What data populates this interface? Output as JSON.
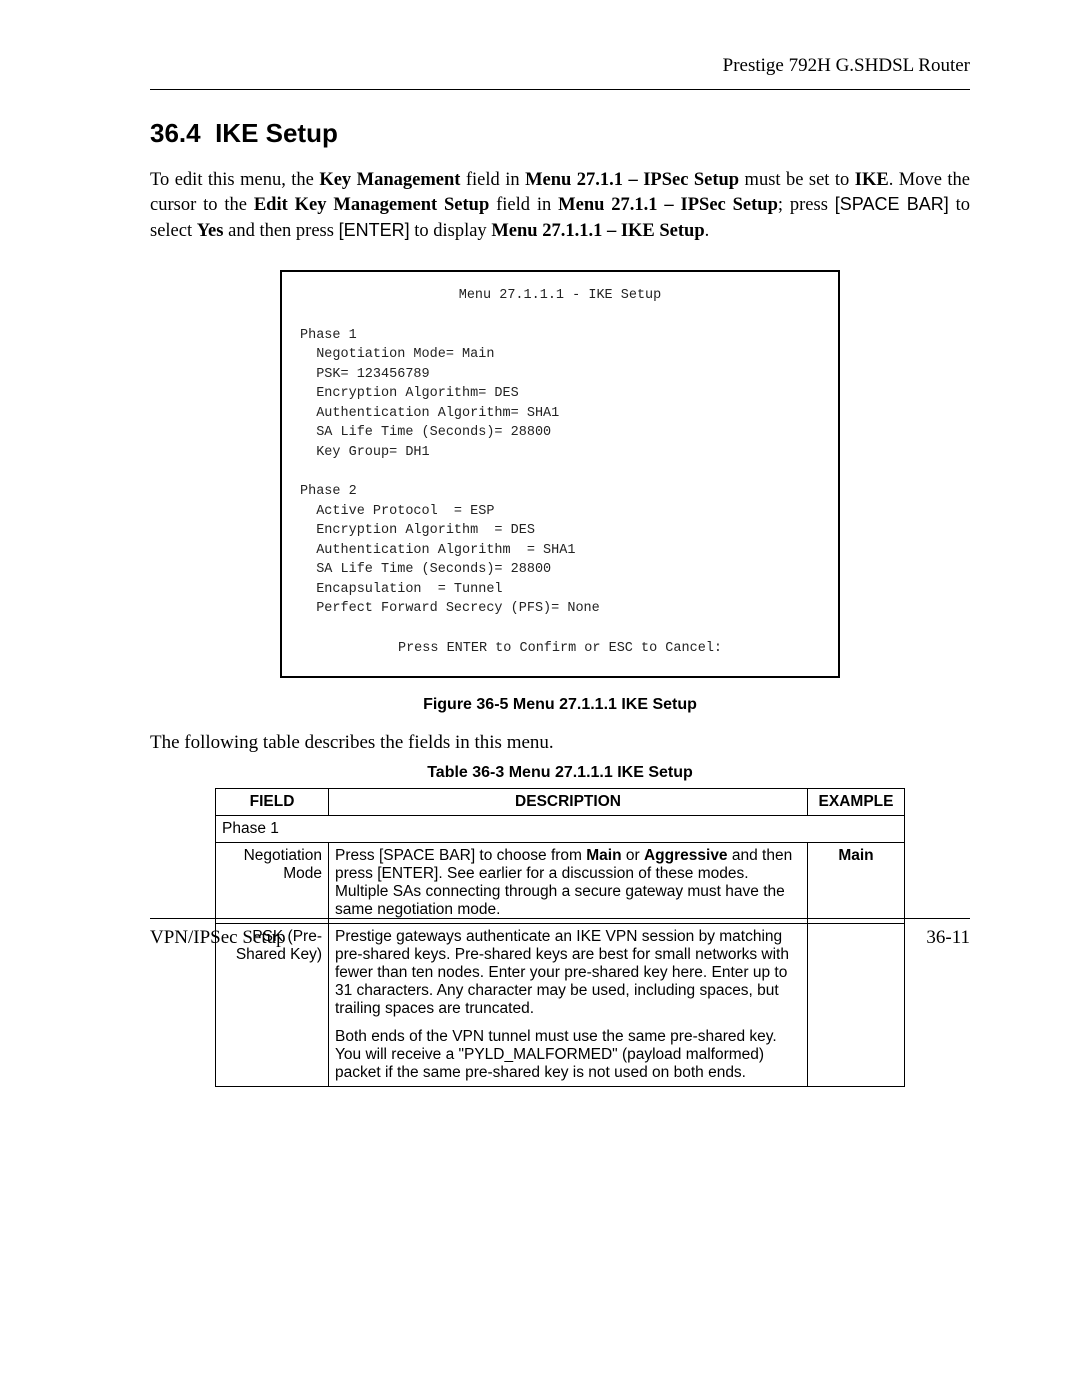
{
  "header": {
    "product": "Prestige 792H G.SHDSL Router"
  },
  "section": {
    "number": "36.4",
    "title": "IKE Setup"
  },
  "intro": {
    "t1": "To edit this menu, the ",
    "t2": "Key Management",
    "t3": " field in ",
    "t4": "Menu 27.1.1 – IPSec Setup",
    "t5": " must be set to ",
    "t6": "IKE",
    "t7": ". Move the cursor to the ",
    "t8": "Edit Key Management Setup",
    "t9": " field in ",
    "t10": "Menu 27.1.1 – IPSec Setup",
    "t11": "; press ",
    "t12": "[SPACE BAR]",
    "t13": " to select ",
    "t14": "Yes",
    "t15": " and then press ",
    "t16": "[ENTER]",
    "t17": " to display ",
    "t18": "Menu 27.1.1.1 – IKE Setup",
    "t19": "."
  },
  "menu": {
    "title": "Menu 27.1.1.1 - IKE Setup",
    "phase1_label": "Phase 1",
    "p1_l1": "Negotiation Mode= Main",
    "p1_l2": "PSK= 123456789",
    "p1_l3": "Encryption Algorithm= DES",
    "p1_l4": "Authentication Algorithm= SHA1",
    "p1_l5": "SA Life Time (Seconds)= 28800",
    "p1_l6": "Key Group= DH1",
    "phase2_label": "Phase 2",
    "p2_l1": "Active Protocol  = ESP",
    "p2_l2": "Encryption Algorithm  = DES",
    "p2_l3": "Authentication Algorithm  = SHA1",
    "p2_l4": "SA Life Time (Seconds)= 28800",
    "p2_l5": "Encapsulation  = Tunnel",
    "p2_l6": "Perfect Forward Secrecy (PFS)= None",
    "prompt": "Press ENTER to Confirm or ESC to Cancel:"
  },
  "figure": {
    "caption": "Figure 36-5 Menu 27.1.1.1 IKE Setup"
  },
  "mid_text": "The following table describes the fields in this menu.",
  "table": {
    "caption": "Table 36-3 Menu 27.1.1.1 IKE Setup",
    "head_field": "FIELD",
    "head_desc": "DESCRIPTION",
    "head_example": "EXAMPLE",
    "phase_row": "Phase 1",
    "row1": {
      "field_l1": "Negotiation",
      "field_l2": "Mode",
      "d1": "Press ",
      "d2": "[SPACE BAR]",
      "d3": " to choose from ",
      "d4": "Main",
      "d5": " or ",
      "d6": "Aggressive",
      "d7": " and then press ",
      "d8": "[ENTER]",
      "d9": ". See earlier for a discussion of these modes. Multiple SAs connecting through a secure gateway must have the same negotiation mode.",
      "example": "Main"
    },
    "row2": {
      "field_l1": "PSK (Pre-",
      "field_l2": "Shared Key)",
      "p1": "Prestige gateways authenticate an IKE VPN session by matching pre-shared keys. Pre-shared keys are best for small networks with fewer than ten nodes. Enter your pre-shared key here. Enter up to 31 characters. Any character may be used, including spaces, but trailing spaces are truncated.",
      "p2": "Both ends of the VPN tunnel must use the same pre-shared key. You will receive a \"PYLD_MALFORMED\" (payload malformed) packet if the same pre-shared key is not used on both ends."
    }
  },
  "footer": {
    "left": "VPN/IPSec Setup",
    "right": "36-11"
  }
}
